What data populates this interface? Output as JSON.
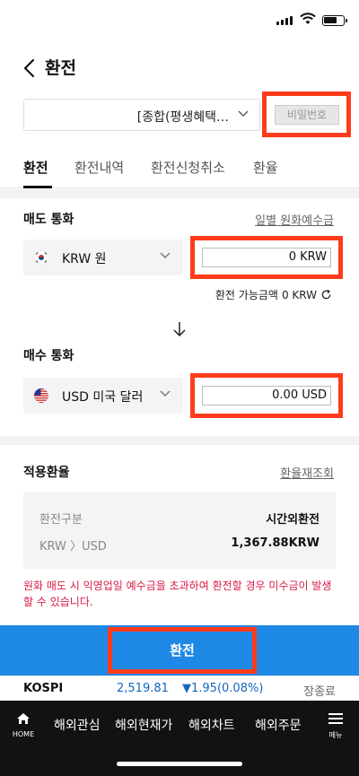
{
  "header": {
    "title": "환전"
  },
  "account": {
    "value": "[종합(평생혜택…",
    "password_placeholder": "비밀번호"
  },
  "tabs": [
    {
      "label": "환전"
    },
    {
      "label": "환전내역"
    },
    {
      "label": "환전신청취소"
    },
    {
      "label": "환율"
    }
  ],
  "sell": {
    "title": "매도 통화",
    "link": "일별 원화예수금",
    "currency": "KRW 원",
    "amount": "0 KRW",
    "available_label": "환전 가능금액",
    "available_value": "0 KRW"
  },
  "buy": {
    "title": "매수 통화",
    "currency": "USD 미국 달러",
    "amount": "0.00 USD"
  },
  "rate": {
    "title": "적용환율",
    "refresh_link": "환율재조회",
    "rows": [
      {
        "key": "환전구분",
        "value": "시간외환전"
      },
      {
        "key": "KRW 〉USD",
        "value": "1,367.88KRW"
      }
    ]
  },
  "warning": "원화 매도 시 익영업일 예수금을 초과하여 환전할 경우 미수금이 발생할 수 있습니다.",
  "submit_label": "환전",
  "ticker": {
    "index": "KOSPI",
    "value": "2,519.81",
    "change": "▼1.95(0.08%)",
    "status": "장종료"
  },
  "bottom_nav": {
    "home_label": "HOME",
    "items": [
      {
        "label": "해외관심"
      },
      {
        "label": "해외현재가"
      },
      {
        "label": "해외차트"
      },
      {
        "label": "해외주문"
      }
    ],
    "menu_label": "메뉴"
  },
  "colors": {
    "accent_blue": "#1e88e5",
    "highlight_red": "#ff3b1c",
    "warning_red": "#d81b44",
    "down_blue": "#1565c0"
  }
}
